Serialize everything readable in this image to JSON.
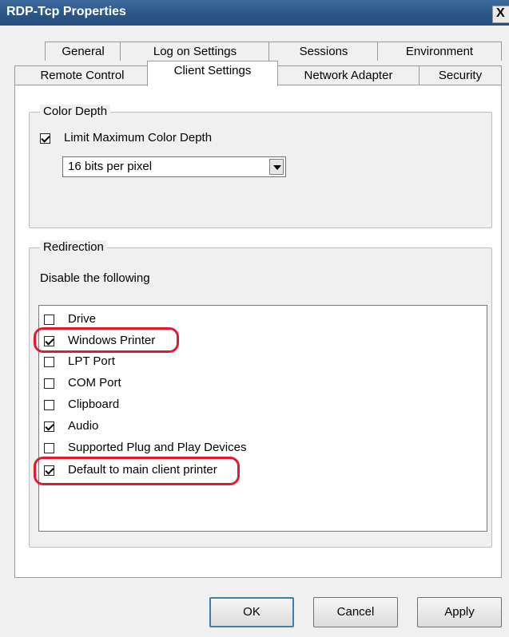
{
  "window": {
    "title": "RDP-Tcp Properties",
    "close_label": "X"
  },
  "tabs": {
    "row1": [
      "General",
      "Log on Settings",
      "Sessions",
      "Environment"
    ],
    "row2": [
      "Remote Control",
      "Client Settings",
      "Network Adapter",
      "Security"
    ],
    "active": "Client Settings"
  },
  "color_depth": {
    "group_label": "Color Depth",
    "limit_label": "Limit Maximum Color Depth",
    "limit_checked": true,
    "selected_value": "16 bits per pixel"
  },
  "redirection": {
    "group_label": "Redirection",
    "description": "Disable the following",
    "items": [
      {
        "label": "Drive",
        "checked": false
      },
      {
        "label": "Windows Printer",
        "checked": true
      },
      {
        "label": "LPT Port",
        "checked": false
      },
      {
        "label": "COM Port",
        "checked": false
      },
      {
        "label": "Clipboard",
        "checked": false
      },
      {
        "label": "Audio",
        "checked": true
      },
      {
        "label": "Supported Plug and Play Devices",
        "checked": false
      },
      {
        "label": "Default to main client printer",
        "checked": true
      }
    ]
  },
  "buttons": {
    "ok": "OK",
    "cancel": "Cancel",
    "apply": "Apply"
  },
  "colors": {
    "titlebar": "#2c5688",
    "highlight": "#e31a2c"
  }
}
